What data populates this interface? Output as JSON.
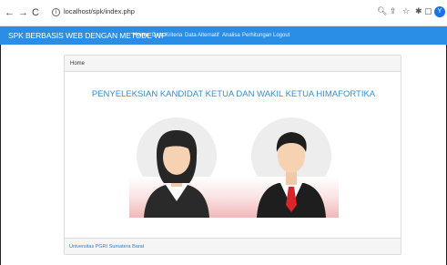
{
  "browser": {
    "back_icon": "arrow-left-icon",
    "forward_icon": "arrow-right-icon",
    "reload_icon": "reload-icon",
    "url": "localhost/spk/index.php",
    "profile_initial": "Y"
  },
  "navbar": {
    "brand": "SPK BERBASIS WEB DENGAN METODE WP",
    "items": [
      {
        "label": "Home"
      },
      {
        "label": "Data Kriteria"
      },
      {
        "label": "Data Alternatif"
      },
      {
        "label": "Analisa"
      },
      {
        "label": "Perhitungan"
      },
      {
        "label": "Logout"
      }
    ]
  },
  "panel": {
    "heading": "Home",
    "title": "PENYELEKSIAN KANDIDAT KETUA DAN WAKIL KETUA HIMAFORTIKA",
    "footer": "Universitas PGRI Sumatera Barat"
  },
  "colors": {
    "navbar": "#2a8ee6",
    "title": "#2f8fe0",
    "tie": "#d9262b",
    "illustration_bg": "#f3c5c5"
  }
}
